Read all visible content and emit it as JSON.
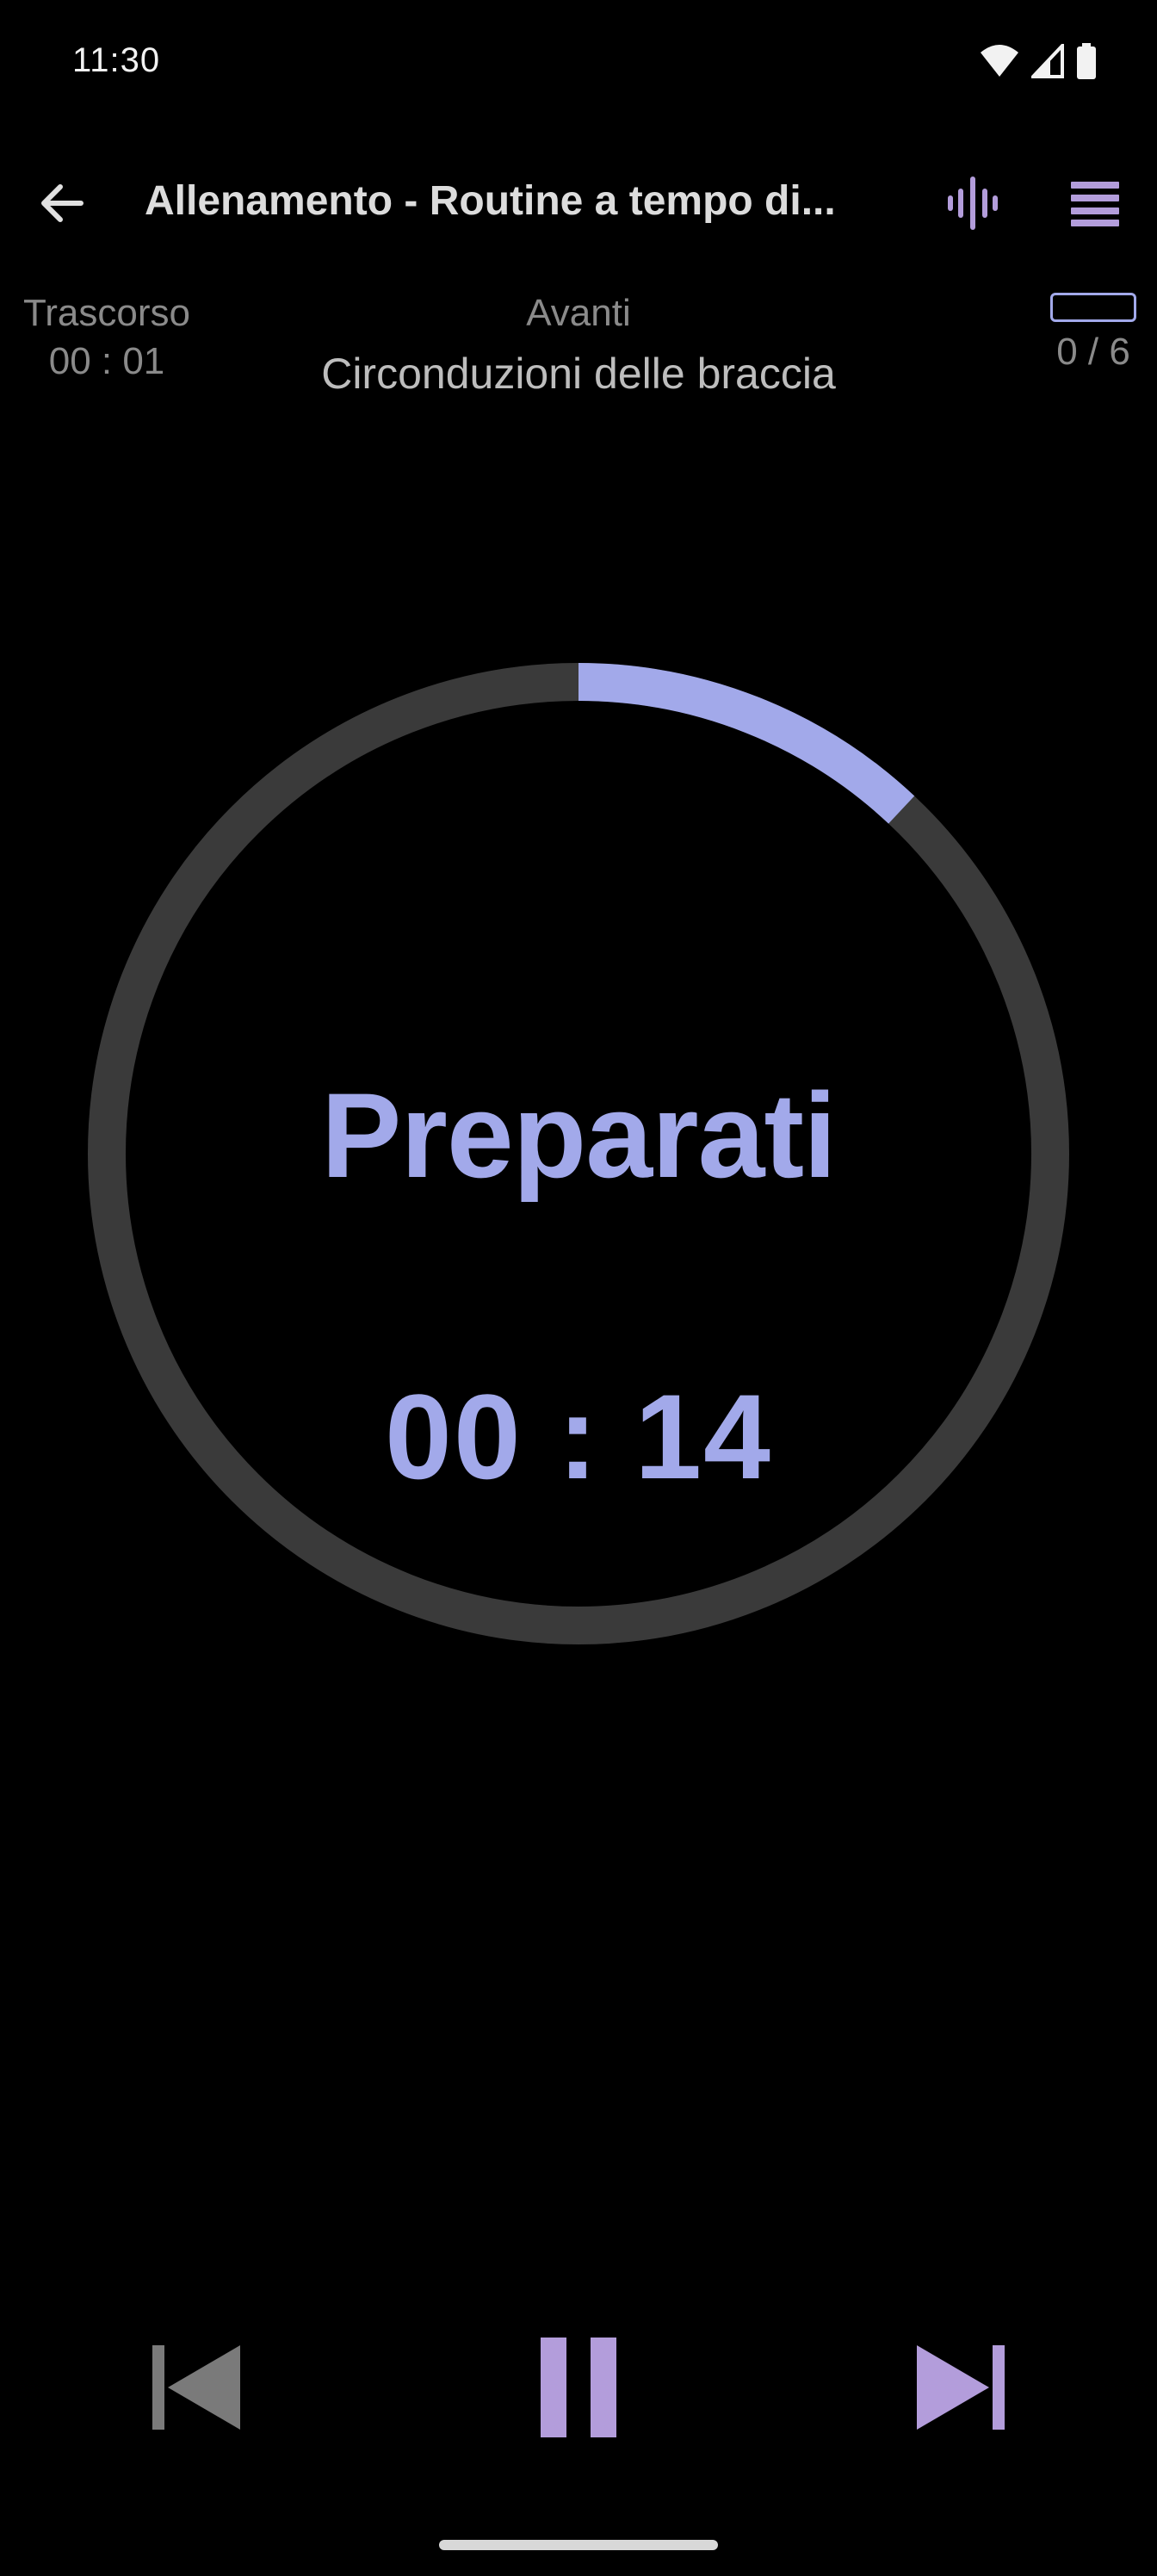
{
  "status_bar": {
    "time": "11:30",
    "icons": [
      "wifi-icon",
      "cellular-signal-icon",
      "battery-icon"
    ]
  },
  "app_bar": {
    "back_icon": "arrow-back-icon",
    "title": "Allenamento - Routine a tempo di...",
    "sound_icon": "audio-waveform-icon",
    "menu_icon": "menu-list-icon"
  },
  "info": {
    "elapsed_label": "Trascorso",
    "elapsed_value": "00 : 01",
    "next_label": "Avanti",
    "next_exercise": "Circonduzioni delle braccia",
    "progress_text": "0 / 6",
    "progress_fraction": 0
  },
  "timer": {
    "phase": "Preparati",
    "countdown": "00 : 14",
    "ring_progress_fraction": 0.12
  },
  "controls": {
    "previous_icon": "skip-previous-icon",
    "pause_icon": "pause-icon",
    "next_icon": "skip-next-icon"
  },
  "colors": {
    "accent": "#a2a9ea",
    "accent_purple": "#b39ddb",
    "ring_track": "#3a3a3a",
    "background": "#000000",
    "muted_text": "#8a8a8a",
    "disabled_icon": "#7a7a7a"
  }
}
